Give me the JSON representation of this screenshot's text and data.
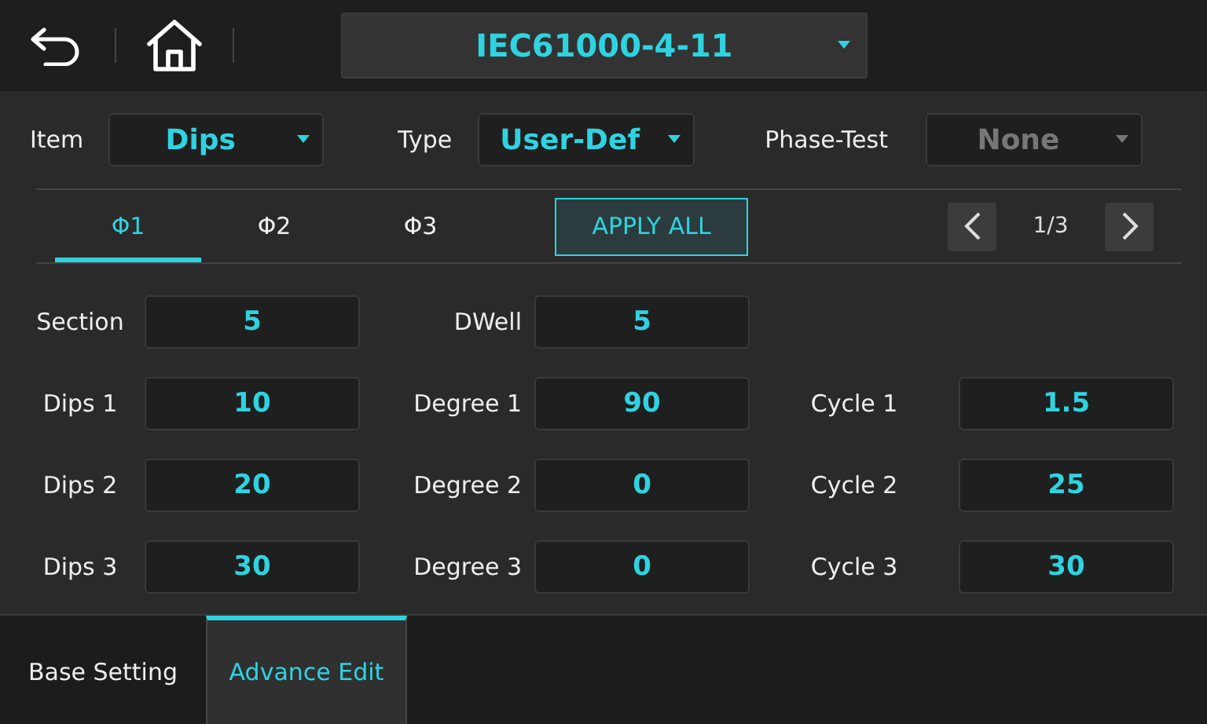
{
  "header": {
    "title": "IEC61000-4-11"
  },
  "selectors": [
    {
      "label": "Item",
      "value": "Dips",
      "disabled": false
    },
    {
      "label": "Type",
      "value": "User-Def",
      "disabled": false
    },
    {
      "label": "Phase-Test",
      "value": "None",
      "disabled": true
    }
  ],
  "phase_tabs": [
    {
      "label": "Φ1",
      "selected": true
    },
    {
      "label": "Φ2",
      "selected": false
    },
    {
      "label": "Φ3",
      "selected": false
    }
  ],
  "apply_button": "APPLY ALL",
  "pager": {
    "text": "1/3"
  },
  "field_rows": [
    {
      "cells": [
        {
          "label": "Section",
          "value": "5"
        },
        {
          "label": "DWell",
          "value": "5"
        }
      ]
    },
    {
      "cells": [
        {
          "label": "Dips 1",
          "value": "10"
        },
        {
          "label": "Degree 1",
          "value": "90"
        },
        {
          "label": "Cycle 1",
          "value": "1.5"
        }
      ]
    },
    {
      "cells": [
        {
          "label": "Dips 2",
          "value": "20"
        },
        {
          "label": "Degree 2",
          "value": "0"
        },
        {
          "label": "Cycle 2",
          "value": "25"
        }
      ]
    },
    {
      "cells": [
        {
          "label": "Dips 3",
          "value": "30"
        },
        {
          "label": "Degree 3",
          "value": "0"
        },
        {
          "label": "Cycle 3",
          "value": "30"
        }
      ]
    }
  ],
  "bottom_tabs": [
    {
      "label": "Base Setting",
      "selected": false
    },
    {
      "label": "Advance Edit",
      "selected": true
    }
  ]
}
